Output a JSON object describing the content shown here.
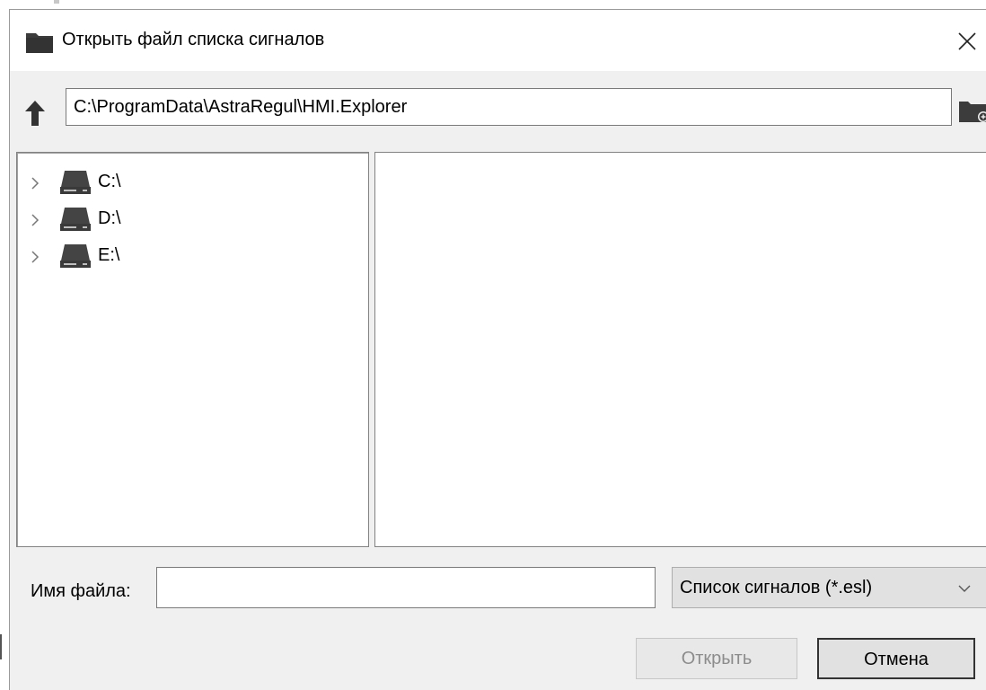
{
  "window": {
    "title": "Открыть файл списка сигналов",
    "title_icon": "folder-icon",
    "close_icon": "close-icon"
  },
  "navigation": {
    "up_icon": "arrow-up-icon",
    "path_value": "C:\\ProgramData\\AstraRegul\\HMI.Explorer",
    "new_folder_icon": "new-folder-icon"
  },
  "tree": {
    "items": [
      {
        "label": "C:\\",
        "icon": "drive-icon",
        "expand_icon": "chevron-right-icon"
      },
      {
        "label": "D:\\",
        "icon": "drive-icon",
        "expand_icon": "chevron-right-icon"
      },
      {
        "label": "E:\\",
        "icon": "drive-icon",
        "expand_icon": "chevron-right-icon"
      }
    ]
  },
  "file_list": {
    "items": []
  },
  "footer": {
    "filename_label": "Имя файла:",
    "filename_value": "",
    "filter_selected": "Список сигналов (*.esl)",
    "filter_icon": "chevron-down-icon",
    "open_label": "Открыть",
    "open_enabled": false,
    "cancel_label": "Отмена"
  },
  "colors": {
    "dialog_bg": "#f0f0f0",
    "titlebar_bg": "#ffffff",
    "button_bg": "#e1e1e1",
    "icon_dark": "#3c3c3c",
    "disabled_text": "#8c8c8c"
  }
}
